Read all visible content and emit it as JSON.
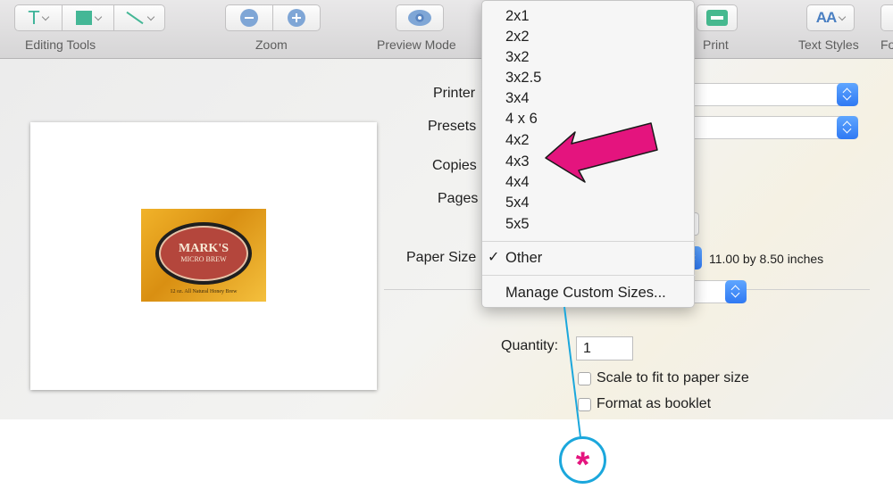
{
  "toolbar": {
    "groups": [
      {
        "label": "Editing Tools"
      },
      {
        "label": "Zoom"
      },
      {
        "label": "Preview Mode"
      },
      {
        "label": "Print"
      },
      {
        "label": "Text Styles"
      },
      {
        "label": "Fo"
      }
    ],
    "editing_tool_text_glyph": "T",
    "text_styles_glyph": "AA"
  },
  "label_art": {
    "brand_line1": "MARK'S",
    "brand_line2": "MICRO BREW",
    "note": "12 oz. All Natural Honey Brew"
  },
  "print_form": {
    "printer_label": "Printer",
    "presets_label": "Presets",
    "copies_label": "Copies",
    "pages_label": "Pages",
    "paper_size_label": "Paper Size",
    "paper_size_value": "11.00 by 8.50 inches",
    "quantity_label": "Quantity:",
    "quantity_value": "1",
    "scale_label": "Scale to fit to paper size",
    "scale_checked": false,
    "booklet_label": "Format as booklet",
    "booklet_checked": false
  },
  "paper_menu": {
    "sizes": [
      "2x1",
      "2x2",
      "3x2",
      "3x2.5",
      "3x4",
      "4 x 6",
      "4x2",
      "4x3",
      "4x4",
      "5x4",
      "5x5"
    ],
    "selected": "Other",
    "checkmark": "✓",
    "manage": "Manage Custom Sizes..."
  },
  "annotations": {
    "arrow_color": "#e4147e",
    "highlighted_item": "4x3",
    "callout_symbol": "*",
    "callout_color": "#1ba7dc"
  }
}
